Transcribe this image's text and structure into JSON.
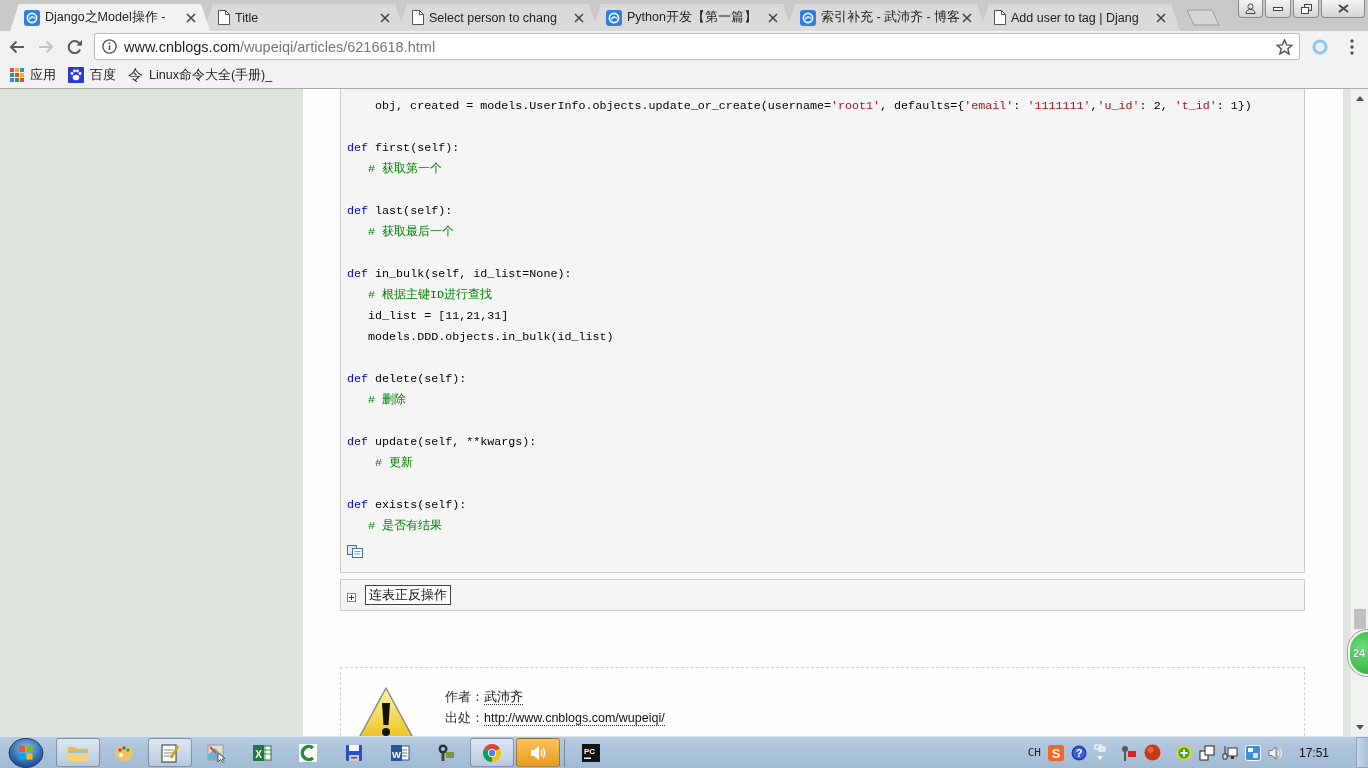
{
  "browser": {
    "tabs": [
      {
        "kind": "site",
        "title": "Django之Model操作 -",
        "selected": true
      },
      {
        "kind": "document",
        "title": "Title",
        "selected": false
      },
      {
        "kind": "document",
        "title": "Select person to chang",
        "selected": false
      },
      {
        "kind": "site",
        "title": "Python开发【第一篇】",
        "selected": false
      },
      {
        "kind": "site",
        "title": "索引补充 - 武沛齐 - 博客",
        "selected": false
      },
      {
        "kind": "document",
        "title": "Add user to tag | Djang",
        "selected": false
      }
    ],
    "nav": [
      {
        "kind": "back",
        "disabled": false
      },
      {
        "kind": "forward",
        "disabled": true
      },
      {
        "kind": "reload",
        "disabled": false
      }
    ],
    "address": {
      "host": "www.cnblogs.com",
      "path": "/wupeiqi/articles/6216618.html"
    },
    "bookmarks": [
      {
        "kind": "apps",
        "label": "应用"
      },
      {
        "kind": "paw",
        "label": "百度"
      },
      {
        "kind": "glyph",
        "glyph": "令",
        "label": "Linux命令大全(手册)_"
      }
    ]
  },
  "page": {
    "code_groups": [
      [
        [
          {
            "kind": "plain",
            "text": "    obj, created = models.UserInfo.objects.update_or_create(username="
          },
          {
            "kind": "string",
            "text": "'root1'"
          },
          {
            "kind": "plain",
            "text": ", defaults={"
          },
          {
            "kind": "string",
            "text": "'email'"
          },
          {
            "kind": "plain",
            "text": ": "
          },
          {
            "kind": "string",
            "text": "'1111111'"
          },
          {
            "kind": "plain",
            "text": ","
          },
          {
            "kind": "string",
            "text": "'u_id'"
          },
          {
            "kind": "plain",
            "text": ": 2, "
          },
          {
            "kind": "string",
            "text": "'t_id'"
          },
          {
            "kind": "plain",
            "text": ": 1})"
          }
        ]
      ],
      [
        [
          {
            "kind": "keyword",
            "text": "def"
          },
          {
            "kind": "plain",
            "text": " first(self):"
          }
        ],
        [
          {
            "kind": "comment",
            "text": "   # 获取第一个"
          }
        ]
      ],
      [
        [
          {
            "kind": "keyword",
            "text": "def"
          },
          {
            "kind": "plain",
            "text": " last(self):"
          }
        ],
        [
          {
            "kind": "comment",
            "text": "   # 获取最后一个"
          }
        ]
      ],
      [
        [
          {
            "kind": "keyword",
            "text": "def"
          },
          {
            "kind": "plain",
            "text": " in_bulk(self, id_list=None):"
          }
        ],
        [
          {
            "kind": "comment",
            "text": "   # 根据主键ID进行查找"
          }
        ],
        [
          {
            "kind": "plain",
            "text": "   id_list = [11,21,31]"
          }
        ],
        [
          {
            "kind": "plain",
            "text": "   models.DDD.objects.in_bulk(id_list)"
          }
        ]
      ],
      [
        [
          {
            "kind": "keyword",
            "text": "def"
          },
          {
            "kind": "plain",
            "text": " delete(self):"
          }
        ],
        [
          {
            "kind": "comment",
            "text": "   # 删除"
          }
        ]
      ],
      [
        [
          {
            "kind": "keyword",
            "text": "def"
          },
          {
            "kind": "plain",
            "text": " update(self, **kwargs):"
          }
        ],
        [
          {
            "kind": "comment",
            "text": "    # 更新"
          }
        ]
      ],
      [
        [
          {
            "kind": "keyword",
            "text": "def"
          },
          {
            "kind": "plain",
            "text": " exists(self):"
          }
        ],
        [
          {
            "kind": "comment",
            "text": "   # 是否有结果"
          }
        ]
      ]
    ],
    "collapsed_block": {
      "title": "连表正反操作",
      "expanded": false
    },
    "author_box": [
      {
        "label": "作者：",
        "link": "武沛齐"
      },
      {
        "label": "出处：",
        "link": "http://www.cnblogs.com/wupeiqi/"
      }
    ],
    "floating_badge": "24"
  },
  "taskbar": {
    "items": [
      {
        "kind": "folder",
        "running": true,
        "active": false
      },
      {
        "kind": "palette",
        "running": false,
        "active": false
      },
      {
        "kind": "notepad",
        "running": true,
        "active": false
      },
      {
        "kind": "picture",
        "running": false,
        "active": false
      },
      {
        "kind": "sheet",
        "glyph": "X",
        "running": false,
        "active": false
      },
      {
        "kind": "arc",
        "running": false,
        "active": false
      },
      {
        "kind": "floppy",
        "running": false,
        "active": false
      },
      {
        "kind": "doc",
        "glyph": "W",
        "running": false,
        "active": false
      },
      {
        "kind": "camera",
        "running": false,
        "active": false
      },
      {
        "kind": "wheel",
        "running": true,
        "active": false
      },
      {
        "kind": "speaker",
        "running": true,
        "active": true
      },
      {
        "kind": "ide",
        "glyph": "PC",
        "running": false,
        "active": false
      }
    ],
    "tray": [
      [
        {
          "kind": "text",
          "glyph": "CH"
        },
        {
          "kind": "tile",
          "glyph": "S"
        },
        {
          "kind": "help",
          "glyph": "?"
        },
        {
          "kind": "windows"
        }
      ],
      [
        {
          "kind": "flag"
        },
        {
          "kind": "dot"
        }
      ],
      [
        {
          "kind": "plus"
        },
        {
          "kind": "stack"
        },
        {
          "kind": "network"
        },
        {
          "kind": "ime"
        },
        {
          "kind": "volume"
        }
      ]
    ],
    "clock": "17:51"
  }
}
